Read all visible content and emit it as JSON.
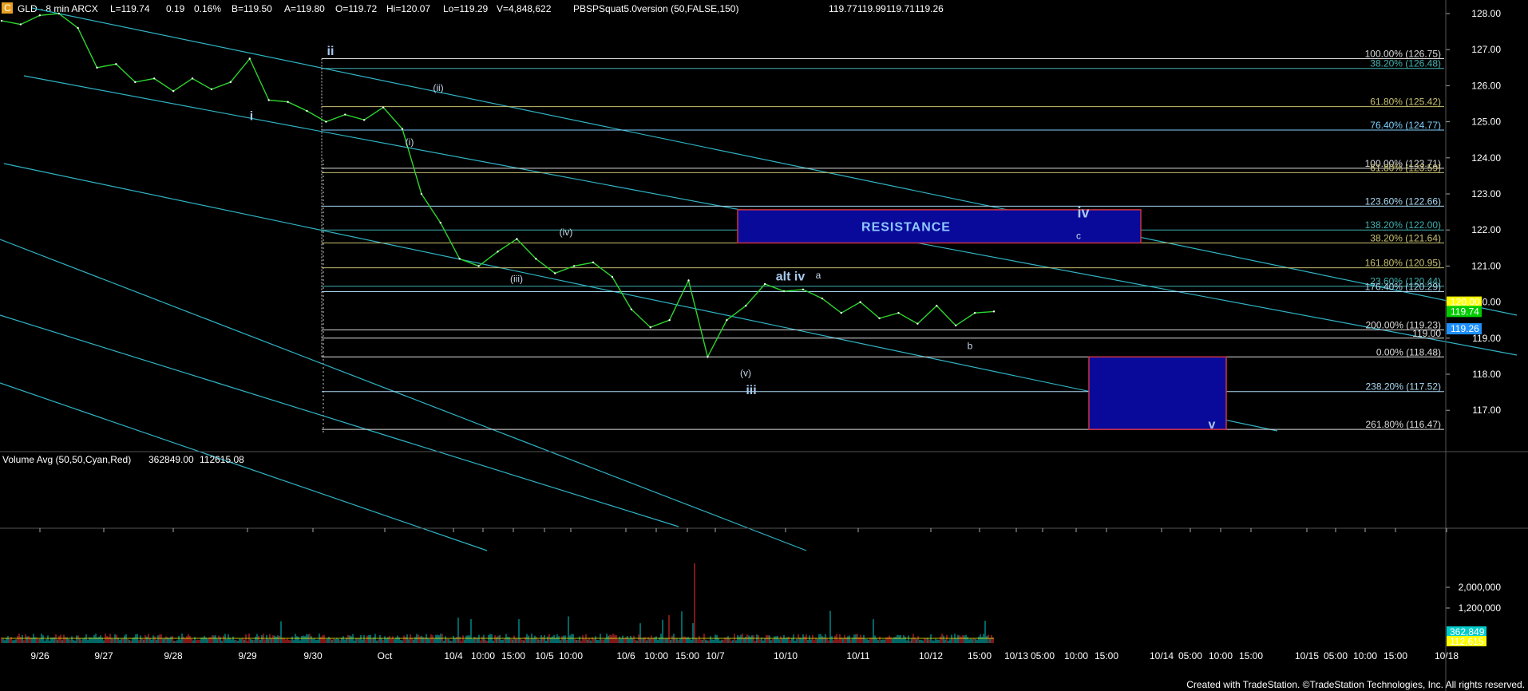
{
  "header": {
    "symbol_icon": "C",
    "title": "GLD - 8 min  ARCX",
    "last": "L=119.74",
    "change": "0.19",
    "change_pct": "0.16%",
    "bid": "B=119.50",
    "ask": "A=119.80",
    "open": "O=119.72",
    "high": "Hi=120.07",
    "low": "Lo=119.29",
    "volume": "V=4,848,622",
    "indicator": "PBSPSquat5.0version (50,FALSE,150)",
    "ind_values": [
      "119.77",
      "119.99",
      "119.71",
      "119.26"
    ],
    "ind_colors": [
      "#6ec6ff",
      "#f0e060",
      "#e040e0",
      "#6ec6ff"
    ]
  },
  "volume_header": {
    "label": "Volume Avg (50,50,Cyan,Red)",
    "value1": "362849.00",
    "value2": "112615.08"
  },
  "footer": {
    "credit": "Created with TradeStation. ©TradeStation Technologies, Inc. All rights reserved."
  },
  "chart_data": {
    "type": "line",
    "ylim": [
      115.6,
      128.3
    ],
    "price_ticks": [
      "128.00",
      "127.00",
      "126.00",
      "125.00",
      "124.00",
      "123.00",
      "122.00",
      "121.00",
      "120.00",
      "119.00",
      "118.00",
      "117.00"
    ],
    "price_tags": [
      {
        "label": "120.00",
        "value": 120.0,
        "bg": "#ffff00",
        "fg": "#000000"
      },
      {
        "label": "119.74",
        "value": 119.74,
        "bg": "#00cc00",
        "fg": "#000000"
      },
      {
        "label": "119.26",
        "value": 119.26,
        "bg": "#1e90ff",
        "fg": "#ffffff"
      }
    ],
    "volume_ticks": [
      "2,000,000",
      "1,200,000"
    ],
    "volume_tags": [
      {
        "label": "362,849",
        "bg": "#00cccc",
        "fg": "#000000"
      },
      {
        "label": "112,615",
        "bg": "#ffff00",
        "fg": "#000000"
      }
    ],
    "x_labels": [
      "9/26",
      "9/27",
      "9/28",
      "9/29",
      "9/30",
      "Oct",
      "10/4",
      "10:00",
      "15:00",
      "10/5",
      "10:00",
      "10/6",
      "10:00",
      "15:00",
      "10/7",
      "10/10",
      "10/11",
      "10/12",
      "15:00",
      "10/13",
      "05:00",
      "10:00",
      "15:00",
      "10/14",
      "05:00",
      "10:00",
      "15:00",
      "10/15",
      "05:00",
      "10:00",
      "15:00",
      "10/18"
    ],
    "fib_levels": [
      {
        "label": "100.00% (126.75)",
        "value": 126.75,
        "color": "#dddddd"
      },
      {
        "label": "38.20% (126.48)",
        "value": 126.48,
        "color": "#40b0b0"
      },
      {
        "label": "61.80% (125.42)",
        "value": 125.42,
        "color": "#c8c070"
      },
      {
        "label": "76.40% (124.77)",
        "value": 124.77,
        "color": "#7fd0ff"
      },
      {
        "label": "100.00% (123.71)",
        "value": 123.71,
        "color": "#dddddd"
      },
      {
        "label": "61.80% (123.59)",
        "value": 123.59,
        "color": "#c8c070"
      },
      {
        "label": "123.60% (122.66)",
        "value": 122.66,
        "color": "#aad8f0"
      },
      {
        "label": "138.20% (122.00)",
        "value": 122.0,
        "color": "#40b0b0"
      },
      {
        "label": "38.20% (121.64)",
        "value": 121.64,
        "color": "#c8c070"
      },
      {
        "label": "161.80% (120.95)",
        "value": 120.95,
        "color": "#c8c070"
      },
      {
        "label": "23.60% (120.44)",
        "value": 120.44,
        "color": "#40b0b0"
      },
      {
        "label": "176.40% (120.29)",
        "value": 120.29,
        "color": "#aad8f0"
      },
      {
        "label": "200.00% (119.23)",
        "value": 119.23,
        "color": "#dddddd"
      },
      {
        "label": "119.00",
        "value": 119.0,
        "color": "#dddddd"
      },
      {
        "label": "0.00% (118.48)",
        "value": 118.48,
        "color": "#dddddd"
      },
      {
        "label": "238.20% (117.52)",
        "value": 117.52,
        "color": "#aad8f0"
      },
      {
        "label": "261.80% (116.47)",
        "value": 116.47,
        "color": "#dddddd"
      }
    ],
    "price_series": [
      [
        0,
        127.8
      ],
      [
        1,
        127.7
      ],
      [
        2,
        127.95
      ],
      [
        3,
        128.0
      ],
      [
        4,
        127.6
      ],
      [
        5,
        126.5
      ],
      [
        6,
        126.6
      ],
      [
        7,
        126.1
      ],
      [
        8,
        126.2
      ],
      [
        9,
        125.85
      ],
      [
        10,
        126.2
      ],
      [
        11,
        125.9
      ],
      [
        12,
        126.1
      ],
      [
        13,
        126.75
      ],
      [
        14,
        125.6
      ],
      [
        15,
        125.55
      ],
      [
        16,
        125.3
      ],
      [
        17,
        125.0
      ],
      [
        18,
        125.2
      ],
      [
        19,
        125.05
      ],
      [
        20,
        125.4
      ],
      [
        21,
        124.8
      ],
      [
        22,
        123.0
      ],
      [
        23,
        122.2
      ],
      [
        24,
        121.2
      ],
      [
        25,
        121.0
      ],
      [
        26,
        121.4
      ],
      [
        27,
        121.75
      ],
      [
        28,
        121.2
      ],
      [
        29,
        120.8
      ],
      [
        30,
        121.0
      ],
      [
        31,
        121.1
      ],
      [
        32,
        120.7
      ],
      [
        33,
        119.8
      ],
      [
        34,
        119.3
      ],
      [
        35,
        119.5
      ],
      [
        36,
        120.6
      ],
      [
        37,
        118.48
      ],
      [
        38,
        119.5
      ],
      [
        39,
        119.9
      ],
      [
        40,
        120.5
      ],
      [
        41,
        120.3
      ],
      [
        42,
        120.35
      ],
      [
        43,
        120.1
      ],
      [
        44,
        119.7
      ],
      [
        45,
        120.0
      ],
      [
        46,
        119.55
      ],
      [
        47,
        119.7
      ],
      [
        48,
        119.4
      ],
      [
        49,
        119.9
      ],
      [
        50,
        119.35
      ],
      [
        51,
        119.7
      ],
      [
        52,
        119.74
      ]
    ],
    "waves": [
      {
        "label": "ii",
        "value": 126.85
      },
      {
        "label": "i",
        "value": 125.05
      },
      {
        "label": "(ii)",
        "value": 125.85
      },
      {
        "label": "(i)",
        "value": 124.35
      },
      {
        "label": "(iv)",
        "value": 121.85
      },
      {
        "label": "(iii)",
        "value": 120.55
      },
      {
        "label": "alt iv",
        "value": 120.6
      },
      {
        "label": "a",
        "value": 120.65
      },
      {
        "label": "iv",
        "value": 122.35
      },
      {
        "label": "c",
        "value": 121.75
      },
      {
        "label": "b",
        "value": 118.7
      },
      {
        "label": "(v)",
        "value": 117.95
      },
      {
        "label": "iii",
        "value": 117.45
      },
      {
        "label": "v",
        "value": 116.5
      }
    ],
    "resistance_box": {
      "label": "RESISTANCE",
      "from": 122.56,
      "to": 121.64
    },
    "target_box": {
      "from": 118.48,
      "to": 116.47
    }
  }
}
